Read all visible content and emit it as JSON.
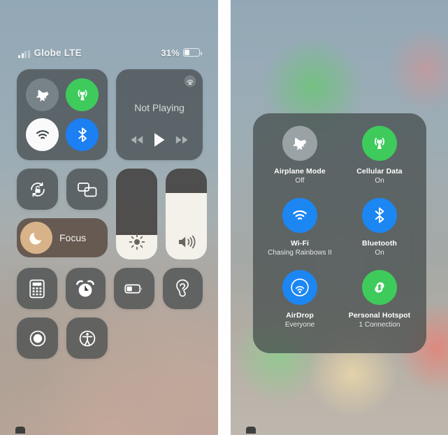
{
  "left_phone": {
    "status_bar": {
      "carrier": "Globe LTE",
      "battery_percent": "31%",
      "battery_level": 31,
      "signal_icon": "cellular-signal-icon"
    },
    "connectivity": {
      "airplane_mode": {
        "icon": "airplane-icon",
        "state": "off",
        "color": "#7c868c"
      },
      "cellular_data": {
        "icon": "cellular-antenna-icon",
        "state": "on",
        "color": "#3ecb5c"
      },
      "wifi": {
        "icon": "wifi-icon",
        "state": "on",
        "color": "#fafafa"
      },
      "bluetooth": {
        "icon": "bluetooth-icon",
        "state": "on",
        "color": "#1c7ff2"
      }
    },
    "media": {
      "title": "Not Playing",
      "airplay_icon": "airplay-audio-icon",
      "previous_icon": "rewind-icon",
      "play_icon": "play-icon",
      "next_icon": "fast-forward-icon"
    },
    "rotation_lock": {
      "icon": "rotation-lock-icon",
      "state": "off"
    },
    "screen_mirroring": {
      "icon": "screen-mirroring-icon",
      "state": "off"
    },
    "focus": {
      "label": "Focus",
      "icon": "moon-icon",
      "state": "on"
    },
    "brightness": {
      "icon": "brightness-icon",
      "value": 27
    },
    "volume": {
      "icon": "volume-icon",
      "value": 73
    },
    "shortcuts": [
      {
        "icon": "calculator-icon",
        "name": "calculator"
      },
      {
        "icon": "alarm-clock-icon",
        "name": "alarm"
      },
      {
        "icon": "low-power-battery-icon",
        "name": "low-power-mode"
      },
      {
        "icon": "hearing-ear-icon",
        "name": "hearing"
      },
      {
        "icon": "screen-record-icon",
        "name": "screen-recording"
      },
      {
        "icon": "accessibility-icon",
        "name": "accessibility"
      }
    ]
  },
  "right_phone": {
    "expanded_connectivity": {
      "items": [
        {
          "title": "Airplane Mode",
          "subtitle": "Off",
          "icon": "airplane-icon",
          "color": "#9aa2a6",
          "state": "off"
        },
        {
          "title": "Cellular Data",
          "subtitle": "On",
          "icon": "cellular-antenna-icon",
          "color": "#3ecb5c",
          "state": "on"
        },
        {
          "title": "Wi-Fi",
          "subtitle": "Chasing Rainbows II",
          "icon": "wifi-icon",
          "color": "#1c86f2",
          "state": "on"
        },
        {
          "title": "Bluetooth",
          "subtitle": "On",
          "icon": "bluetooth-icon",
          "color": "#1c86f2",
          "state": "on"
        },
        {
          "title": "AirDrop",
          "subtitle": "Everyone",
          "icon": "airdrop-icon",
          "color": "#1c86f2",
          "state": "on"
        },
        {
          "title": "Personal Hotspot",
          "subtitle": "1 Connection",
          "icon": "hotspot-icon",
          "color": "#3ecb5c",
          "state": "on"
        }
      ]
    }
  },
  "theme": {
    "module_bg": "#42484a",
    "green": "#3ecb5c",
    "blue": "#1c7ff2",
    "white": "#fafafa",
    "focus_tint": "#544238",
    "focus_circle": "#d8b389"
  }
}
